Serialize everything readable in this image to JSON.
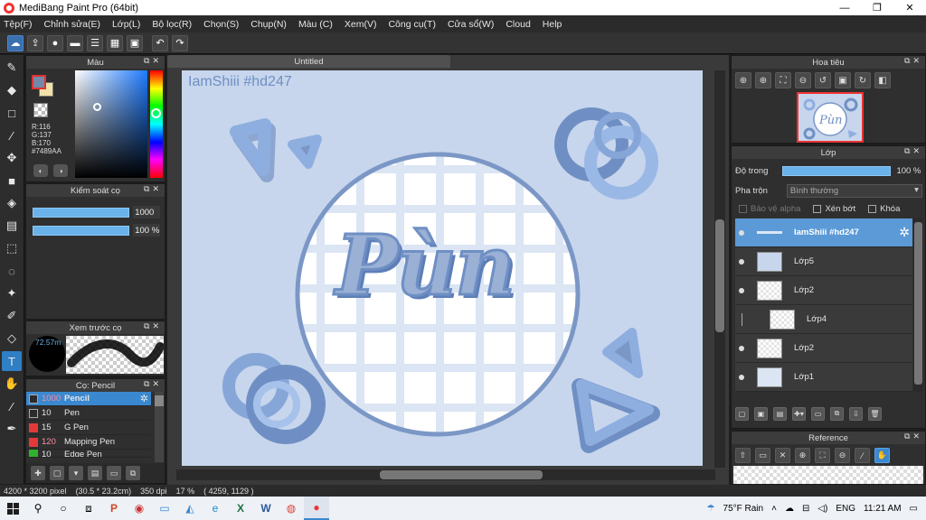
{
  "window": {
    "title": "MediBang Paint Pro (64bit)",
    "minimize": "—",
    "maximize": "❐",
    "close": "✕"
  },
  "menu": [
    "Tệp(F)",
    "Chỉnh sửa(E)",
    "Lớp(L)",
    "Bộ lọc(R)",
    "Chọn(S)",
    "Chụp(N)",
    "Màu (C)",
    "Xem(V)",
    "Công cụ(T)",
    "Cửa sổ(W)",
    "Cloud",
    "Help"
  ],
  "toolbar_icons": [
    "cloud-icon",
    "upload-icon",
    "chat-icon",
    "comment-icon",
    "list-icon",
    "grid-icon",
    "tiles-icon",
    "undo-icon",
    "redo-icon"
  ],
  "color_panel": {
    "title": "Màu",
    "rgb": {
      "r": "R:116",
      "g": "G:137",
      "b": "B:170",
      "hex": "#7489AA"
    },
    "foreground": "#7489AA",
    "background": "#f1e2a8"
  },
  "brush_control": {
    "title": "Kiểm soát cọ",
    "size": "1000",
    "opacity": "100 %"
  },
  "brush_preview": {
    "title": "Xem trước cọ",
    "size": "72.57m"
  },
  "brush_list": {
    "title": "Cọ: Pencil",
    "items": [
      {
        "size": "1000",
        "name": "Pencil",
        "color": "#2b2b2b",
        "selected": true
      },
      {
        "size": "10",
        "name": "Pen",
        "color": "#2b2b2b"
      },
      {
        "size": "15",
        "name": "G Pen",
        "color": "#e23a3a"
      },
      {
        "size": "120",
        "name": "Mapping Pen",
        "color": "#e23a3a"
      },
      {
        "size": "10",
        "name": "Edge Pen",
        "color": "#2fb02f"
      }
    ]
  },
  "document": {
    "tab": "Untitled",
    "watermark": "IamShiii #hd247",
    "art_text": "Pùn"
  },
  "navigator": {
    "title": "Hoa tiêu"
  },
  "layer_panel": {
    "title": "Lớp",
    "opacity_label": "Độ trong",
    "opacity_value": "100 %",
    "opacity_fraction": 1.0,
    "blend_label": "Pha trộn",
    "blend_value": "Bình thường",
    "protect_alpha": "Bảo vệ alpha",
    "clipping": "Xén bớt",
    "lock": "Khóa",
    "layers": [
      {
        "name": "IamShiii #hd247",
        "selected": true
      },
      {
        "name": "Lớp5"
      },
      {
        "name": "Lớp2"
      },
      {
        "name": "Lớp4",
        "indent": true
      },
      {
        "name": "Lớp2"
      },
      {
        "name": "Lớp1"
      }
    ]
  },
  "reference": {
    "title": "Reference"
  },
  "status": {
    "size": "4200 * 3200 pixel",
    "cm": "(30.5 * 23.2cm)",
    "dpi": "350 dpi",
    "zoom": "17 %",
    "coords": "( 4259, 1129 )"
  },
  "taskbar": {
    "weather": "75°F Rain",
    "lang": "ENG",
    "time": "11:21 AM"
  }
}
